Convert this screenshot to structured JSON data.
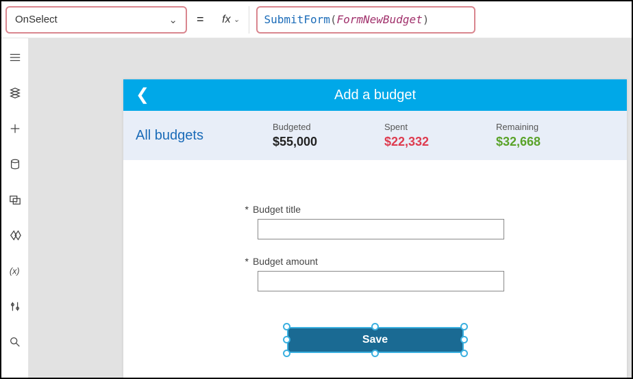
{
  "property_dropdown": {
    "value": "OnSelect"
  },
  "fx_label": "fx",
  "formula": {
    "func": "SubmitForm",
    "open": "(",
    "arg": "FormNewBudget",
    "close": ")"
  },
  "app": {
    "header_title": "Add a budget",
    "all_budgets": "All budgets",
    "stats": {
      "budgeted_label": "Budgeted",
      "budgeted_value": "$55,000",
      "spent_label": "Spent",
      "spent_value": "$22,332",
      "remaining_label": "Remaining",
      "remaining_value": "$32,668"
    },
    "form": {
      "title_label": "Budget title",
      "amount_label": "Budget amount",
      "required_mark": "*",
      "save_label": "Save"
    }
  },
  "rail_icons": [
    "tree-icon",
    "screens-icon",
    "insert-icon",
    "data-icon",
    "media-icon",
    "powerfx-icon",
    "variables-icon",
    "tools-icon",
    "search-icon"
  ]
}
